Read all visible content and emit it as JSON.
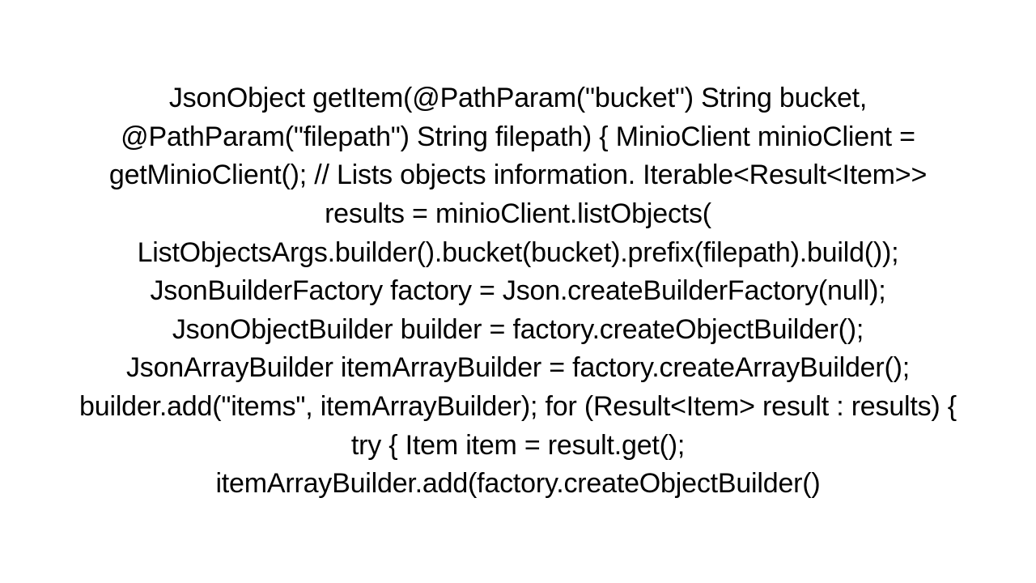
{
  "code": {
    "text": "JsonObject getItem(@PathParam(\"bucket\") String bucket, @PathParam(\"filepath\") String filepath) {         MinioClient minioClient = getMinioClient();            // Lists objects information.         Iterable<Result<Item>> results = minioClient.listObjects(                 ListObjectsArgs.builder().bucket(bucket).prefix(filepath).build());          JsonBuilderFactory factory = Json.createBuilderFactory(null);         JsonObjectBuilder builder = factory.createObjectBuilder();         JsonArrayBuilder itemArrayBuilder = factory.createArrayBuilder();         builder.add(\"items\", itemArrayBuilder);          for (Result<Item> result : results) {             try {                 Item item = result.get();                 itemArrayBuilder.add(factory.createObjectBuilder()"
  }
}
